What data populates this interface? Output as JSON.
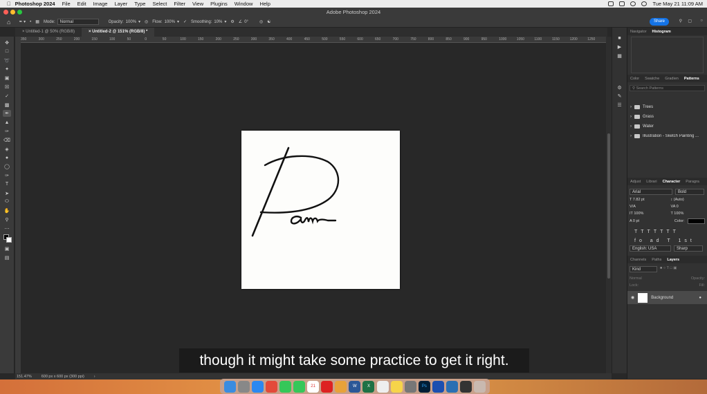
{
  "menubar": {
    "app": "Photoshop 2024",
    "items": [
      "File",
      "Edit",
      "Image",
      "Layer",
      "Type",
      "Select",
      "Filter",
      "View",
      "Plugins",
      "Window",
      "Help"
    ],
    "clock": "Tue May 21  11:09 AM"
  },
  "window": {
    "title": "Adobe Photoshop 2024"
  },
  "options": {
    "mode_label": "Mode:",
    "mode_value": "Normal",
    "opacity_label": "Opacity:",
    "opacity_value": "100%",
    "flow_label": "Flow:",
    "flow_value": "100%",
    "smoothing_label": "Smoothing:",
    "smoothing_value": "10%",
    "angle_value": "0°",
    "share_label": "Share"
  },
  "tabs": [
    {
      "label": "Untitled-1 @ 50% (RGB/8)"
    },
    {
      "label": "Untitled-2 @ 151% (RGB/8) *"
    }
  ],
  "ruler": {
    "labels": [
      "350",
      "300",
      "250",
      "200",
      "150",
      "100",
      "50",
      "0",
      "50",
      "100",
      "150",
      "200",
      "250",
      "300",
      "350",
      "400",
      "450",
      "500",
      "550",
      "600",
      "650",
      "700",
      "750",
      "800",
      "850",
      "900",
      "950",
      "1000",
      "1050",
      "1100",
      "1150",
      "1200",
      "1250"
    ]
  },
  "panels": {
    "top_tabs": [
      "Navigator",
      "Histogram"
    ],
    "swatch_tabs": [
      "Color",
      "Swatche",
      "Gradien",
      "Patterns"
    ],
    "search_placeholder": "Search Patterns",
    "pattern_groups": [
      "Trees",
      "Grass",
      "Water",
      "Illustration - Sketch Painting ..."
    ],
    "char_tabs": [
      "Adjust",
      "Librari",
      "Character",
      "Paragra"
    ],
    "font_family": "Arial",
    "font_style": "Bold",
    "font_size": "7.82 pt",
    "leading": "(Auto)",
    "tracking": "0",
    "vertical_scale": "100%",
    "horizontal_scale": "100%",
    "baseline": "0 pt",
    "color_label": "Color:",
    "language": "English: USA",
    "antialias": "Sharp",
    "layer_tabs": [
      "Channels",
      "Paths",
      "Layers"
    ],
    "kind_label": "Kind",
    "blend_mode": "Normal",
    "opacity_label": "Opacity:",
    "lock_label": "Lock:",
    "fill_label": "Fill:",
    "layer_name": "Background"
  },
  "status": {
    "zoom": "151.47%",
    "doc_size": "600 px x 600 px (300 ppi)"
  },
  "caption": "though it might take some practice to get it right.",
  "dock_icons": [
    "finder-icon",
    "launchpad-icon",
    "safari-icon",
    "chrome-icon",
    "facetime-icon",
    "messages-icon",
    "calendar-icon",
    "acrobat-icon",
    "chrome2-icon",
    "word-icon",
    "excel-icon",
    "reminders-icon",
    "notes-icon",
    "settings-icon",
    "photoshop-icon",
    "wd-icon",
    "vpn-icon",
    "obs-icon",
    "trash-icon"
  ],
  "colors": {
    "accent": "#1473e6"
  }
}
